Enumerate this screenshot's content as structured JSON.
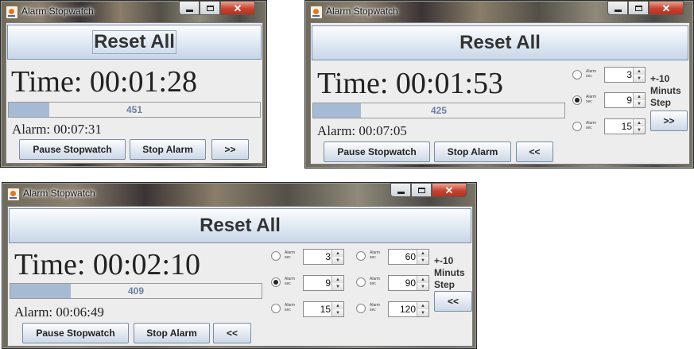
{
  "title_icon": "java-coffee-cup-icon",
  "windows": [
    {
      "title": "Alarm Stopwatch",
      "reset_label": "Reset All",
      "time_text": "Time: 00:01:28",
      "progress_text": "451",
      "progress_fraction": 0.16,
      "alarm_text": "Alarm: 00:07:31",
      "pause_label": "Pause Stopwatch",
      "stop_label": "Stop Alarm",
      "toggle_label": ">>"
    },
    {
      "title": "Alarm Stopwatch",
      "reset_label": "Reset All",
      "time_text": "Time: 00:01:53",
      "progress_text": "425",
      "progress_fraction": 0.19,
      "alarm_text": "Alarm: 00:07:05",
      "pause_label": "Pause Stopwatch",
      "stop_label": "Stop Alarm",
      "toggle_label": "<<",
      "presets": [
        {
          "mini_label": "Alarm\nsec",
          "value": "3",
          "selected": false
        },
        {
          "mini_label": "Alarm\nsec",
          "value": "9",
          "selected": true
        },
        {
          "mini_label": "Alarm\nsec",
          "value": "15",
          "selected": false
        }
      ],
      "step_label": "+-10\nMinuts\nStep",
      "step_button_label": ">>"
    },
    {
      "title": "Alarm Stopwatch",
      "reset_label": "Reset All",
      "time_text": "Time: 00:02:10",
      "progress_text": "409",
      "progress_fraction": 0.24,
      "alarm_text": "Alarm: 00:06:49",
      "pause_label": "Pause Stopwatch",
      "stop_label": "Stop Alarm",
      "toggle_label": "<<",
      "presets": [
        {
          "mini_label": "Alarm\nsec",
          "value": "3",
          "selected": false
        },
        {
          "mini_label": "Alarm\nsec",
          "value": "9",
          "selected": true
        },
        {
          "mini_label": "Alarm\nsec",
          "value": "15",
          "selected": false
        },
        {
          "mini_label": "Alarm\nsec",
          "value": "60",
          "selected": false
        },
        {
          "mini_label": "Alarm\nsec",
          "value": "90",
          "selected": false
        },
        {
          "mini_label": "Alarm\nsec",
          "value": "120",
          "selected": false
        }
      ],
      "step_label": "+-10\nMinuts\nStep",
      "step_button_label": "<<"
    }
  ]
}
